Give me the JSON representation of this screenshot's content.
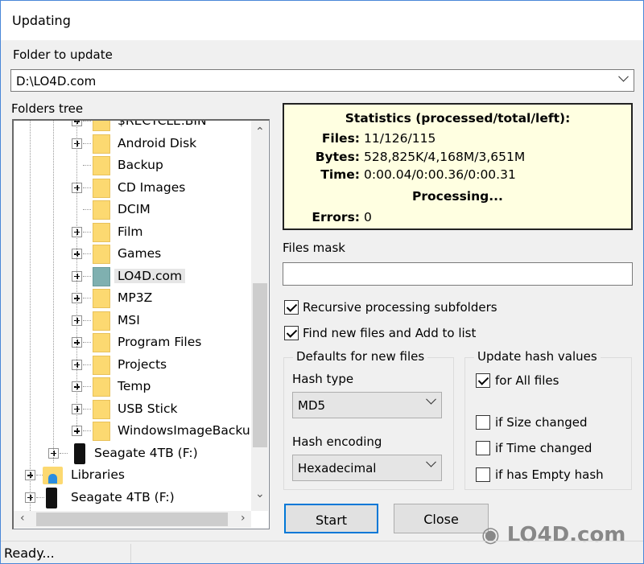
{
  "window": {
    "title": "Updating"
  },
  "folder": {
    "label": "Folder to update",
    "value": "D:\\LO4D.com"
  },
  "tree": {
    "label": "Folders tree",
    "items": [
      {
        "label": "$RECYCLE.BIN",
        "level": 2,
        "icon": "folder-icon",
        "expandable": true
      },
      {
        "label": "Android Disk",
        "level": 2,
        "icon": "folder-icon",
        "expandable": true
      },
      {
        "label": "Backup",
        "level": 2,
        "icon": "folder-icon",
        "expandable": false
      },
      {
        "label": "CD Images",
        "level": 2,
        "icon": "folder-icon",
        "expandable": true
      },
      {
        "label": "DCIM",
        "level": 2,
        "icon": "folder-icon",
        "expandable": false
      },
      {
        "label": "Film",
        "level": 2,
        "icon": "folder-icon",
        "expandable": true
      },
      {
        "label": "Games",
        "level": 2,
        "icon": "folder-icon",
        "expandable": true
      },
      {
        "label": "LO4D.com",
        "level": 2,
        "icon": "folder-icon",
        "expandable": true,
        "selected": true
      },
      {
        "label": "MP3Z",
        "level": 2,
        "icon": "folder-icon",
        "expandable": true
      },
      {
        "label": "MSI",
        "level": 2,
        "icon": "folder-icon",
        "expandable": true
      },
      {
        "label": "Program Files",
        "level": 2,
        "icon": "folder-icon",
        "expandable": true
      },
      {
        "label": "Projects",
        "level": 2,
        "icon": "folder-icon",
        "expandable": true
      },
      {
        "label": "Temp",
        "level": 2,
        "icon": "folder-icon",
        "expandable": true
      },
      {
        "label": "USB Stick",
        "level": 2,
        "icon": "folder-icon",
        "expandable": true
      },
      {
        "label": "WindowsImageBackup",
        "level": 2,
        "icon": "folder-icon",
        "expandable": true
      },
      {
        "label": "Seagate 4TB (F:)",
        "level": 1,
        "icon": "drive-icon",
        "expandable": true
      },
      {
        "label": "Libraries",
        "level": 0,
        "icon": "libraries-icon",
        "expandable": true
      },
      {
        "label": "Seagate 4TB (F:)",
        "level": 0,
        "icon": "drive-icon",
        "expandable": true
      }
    ]
  },
  "stats": {
    "title": "Statistics (processed/total/left):",
    "files_label": "Files:",
    "files": "11/126/115",
    "bytes_label": "Bytes:",
    "bytes": "528,825K/4,168M/3,651M",
    "time_label": "Time:",
    "time": "0:00.04/0:00.36/0:00.31",
    "state": "Processing...",
    "errors_label": "Errors:",
    "errors": "0",
    "background": "#ffffe1"
  },
  "files_mask": {
    "label": "Files mask",
    "value": ""
  },
  "options": {
    "recursive": {
      "label": "Recursive processing subfolders",
      "checked": true
    },
    "find_new": {
      "label": "Find new files and Add to list",
      "checked": true
    }
  },
  "defaults": {
    "title": "Defaults for new files",
    "hash_type_label": "Hash type",
    "hash_type": "MD5",
    "hash_encoding_label": "Hash encoding",
    "hash_encoding": "Hexadecimal"
  },
  "update_hash": {
    "title": "Update hash values",
    "all": {
      "label": "for All files",
      "checked": true
    },
    "size": {
      "label": "if Size changed",
      "checked": false
    },
    "time": {
      "label": "if Time changed",
      "checked": false
    },
    "empty": {
      "label": "if has Empty hash",
      "checked": false
    }
  },
  "buttons": {
    "start": "Start",
    "close": "Close"
  },
  "status": {
    "text": "Ready..."
  },
  "watermark": "LO4D.com"
}
